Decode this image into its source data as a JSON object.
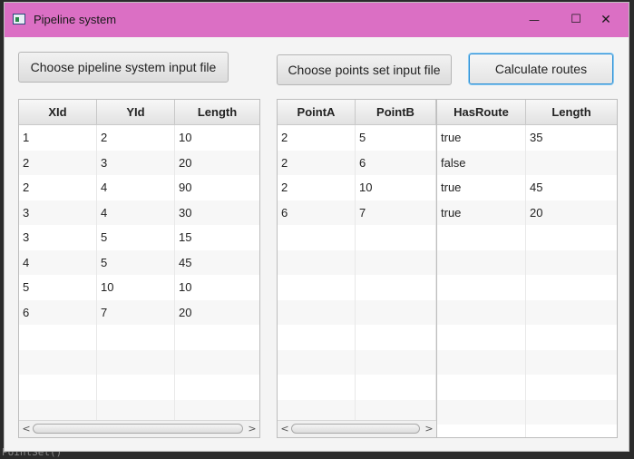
{
  "window": {
    "title": "Pipeline system",
    "minimize_glyph": "—",
    "maximize_glyph": "☐",
    "close_glyph": "✕"
  },
  "background": {
    "code_hint": "PointSet()"
  },
  "buttons": {
    "choose_pipeline": "Choose pipeline system input file",
    "choose_points": "Choose points set input file",
    "calculate": "Calculate routes"
  },
  "pipeline_table": {
    "headers": [
      "XId",
      "YId",
      "Length"
    ],
    "rows": [
      [
        "1",
        "2",
        "10"
      ],
      [
        "2",
        "3",
        "20"
      ],
      [
        "2",
        "4",
        "90"
      ],
      [
        "3",
        "4",
        "30"
      ],
      [
        "3",
        "5",
        "15"
      ],
      [
        "4",
        "5",
        "45"
      ],
      [
        "5",
        "10",
        "10"
      ],
      [
        "6",
        "7",
        "20"
      ]
    ]
  },
  "points_table": {
    "headers": [
      "PointA",
      "PointB"
    ],
    "rows": [
      [
        "2",
        "5"
      ],
      [
        "2",
        "6"
      ],
      [
        "2",
        "10"
      ],
      [
        "6",
        "7"
      ]
    ]
  },
  "routes_table": {
    "headers": [
      "HasRoute",
      "Length"
    ],
    "rows": [
      [
        "true",
        "35"
      ],
      [
        "false",
        ""
      ],
      [
        "true",
        "45"
      ],
      [
        "true",
        "20"
      ]
    ]
  },
  "scroll": {
    "left_arrow": "<",
    "right_arrow": ">"
  },
  "colors": {
    "titlebar": "#db6fc4",
    "focus": "#2b8fd6"
  }
}
